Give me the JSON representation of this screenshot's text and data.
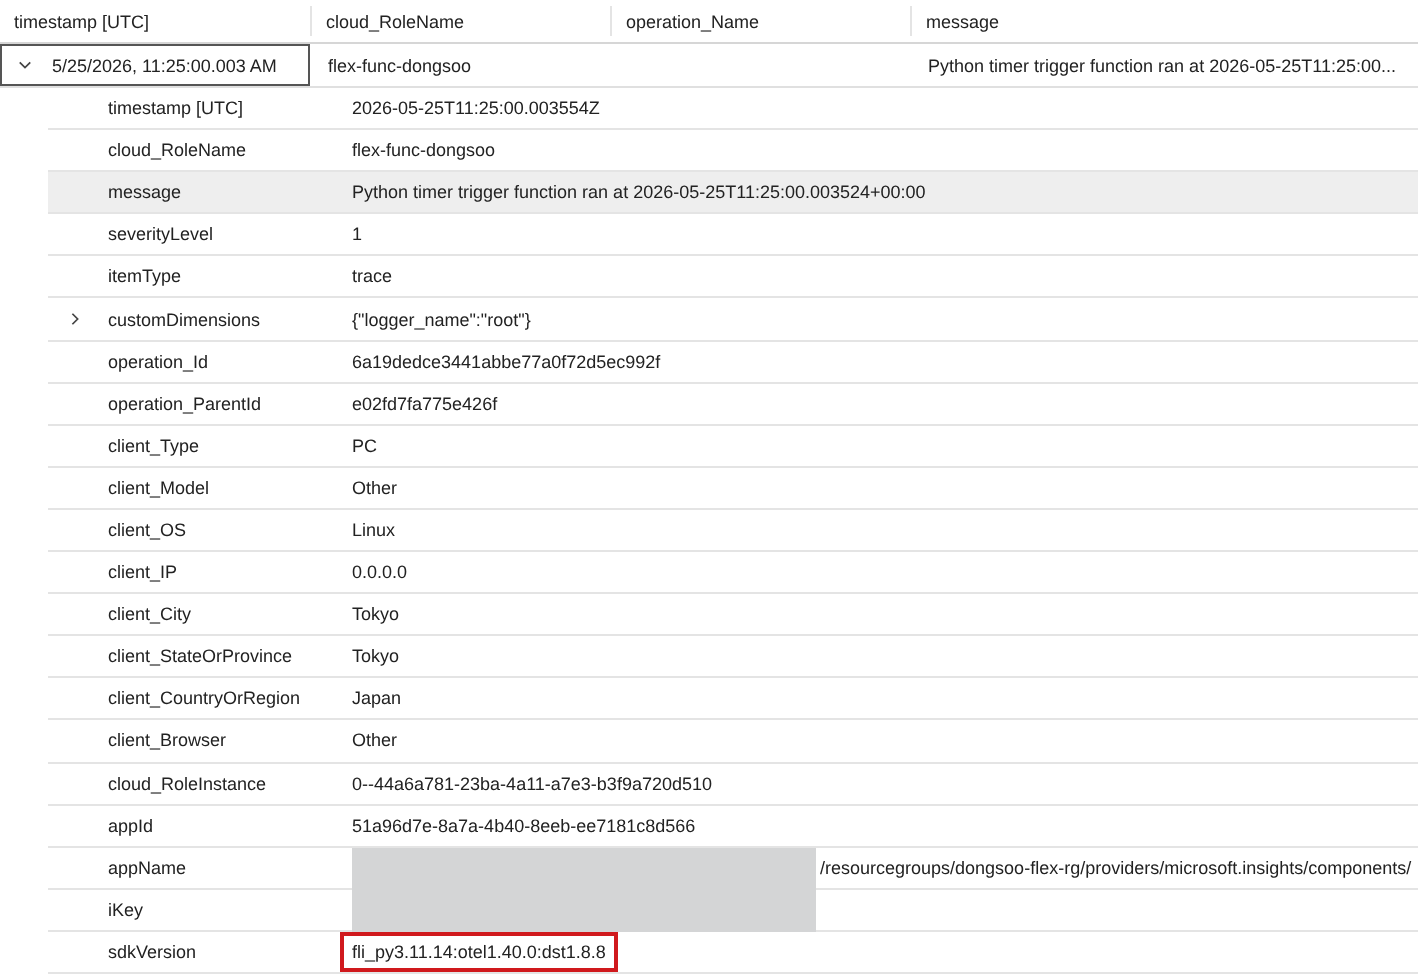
{
  "columns": [
    "timestamp [UTC]",
    "cloud_RoleName",
    "operation_Name",
    "message"
  ],
  "record": {
    "expanded": true,
    "timestamp": "5/25/2026, 11:25:00.003 AM",
    "cloud_RoleName": "flex-func-dongsoo",
    "message": "Python timer trigger function ran at 2026-05-25T11:25:00..."
  },
  "fields": [
    {
      "name": "timestamp [UTC]",
      "value": "2026-05-25T11:25:00.003554Z",
      "selected": false
    },
    {
      "name": "cloud_RoleName",
      "value": "flex-func-dongsoo",
      "selected": false
    },
    {
      "name": "message",
      "value": "Python timer trigger function ran at 2026-05-25T11:25:00.003524+00:00",
      "selected": true
    },
    {
      "name": "severityLevel",
      "value": "1",
      "selected": false
    },
    {
      "name": "itemType",
      "value": "trace",
      "selected": false
    },
    {
      "name": "customDimensions",
      "value": "{\"logger_name\":\"root\"}",
      "selected": false,
      "expanded": false
    },
    {
      "name": "operation_Id",
      "value": "6a19dedce3441abbe77a0f72d5ec992f",
      "selected": false
    },
    {
      "name": "operation_ParentId",
      "value": "e02fd7fa775e426f",
      "selected": false
    },
    {
      "name": "client_Type",
      "value": "PC",
      "selected": false
    },
    {
      "name": "client_Model",
      "value": "Other",
      "selected": false
    },
    {
      "name": "client_OS",
      "value": "Linux",
      "selected": false
    },
    {
      "name": "client_IP",
      "value": "0.0.0.0",
      "selected": false
    },
    {
      "name": "client_City",
      "value": "Tokyo",
      "selected": false
    },
    {
      "name": "client_StateOrProvince",
      "value": "Tokyo",
      "selected": false
    },
    {
      "name": "client_CountryOrRegion",
      "value": "Japan",
      "selected": false
    },
    {
      "name": "client_Browser",
      "value": "Other",
      "selected": false
    },
    {
      "name": "cloud_RoleInstance",
      "value": "0--44a6a781-23ba-4a11-a7e3-b3f9a720d510",
      "selected": false
    },
    {
      "name": "appId",
      "value": "51a96d7e-8a7a-4b40-8eeb-ee7181c8d566",
      "selected": false
    },
    {
      "name": "appName",
      "value": "/resourcegroups/dongsoo-flex-rg/providers/microsoft.insights/components/",
      "selected": false,
      "redacted": true
    },
    {
      "name": "iKey",
      "selected": false,
      "redacted": true
    },
    {
      "name": "sdkVersion",
      "value": "fli_py3.11.14:otel1.40.0:dst1.8.8",
      "selected": false,
      "highlighted": true
    }
  ]
}
